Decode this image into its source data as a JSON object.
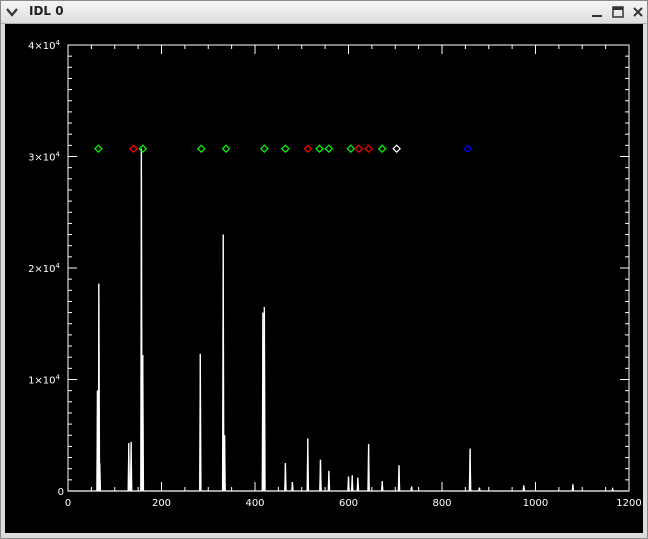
{
  "window": {
    "title": "IDL 0",
    "icons": {
      "menu": "chevron-down-icon",
      "minimize": "minimize-icon",
      "maximize": "maximize-icon",
      "close": "close-icon"
    }
  },
  "colors": {
    "plot_background": "#000000",
    "plot_line": "#ffffff",
    "marker_green": "#00ff00",
    "marker_red": "#ff0000",
    "marker_blue": "#0000ff",
    "marker_white": "#ffffff"
  },
  "chart_data": {
    "type": "line",
    "title": "",
    "xlabel": "",
    "ylabel": "",
    "xlim": [
      0,
      1200
    ],
    "ylim": [
      0,
      40000
    ],
    "xticks": [
      {
        "value": 0,
        "label": "0"
      },
      {
        "value": 200,
        "label": "200"
      },
      {
        "value": 400,
        "label": "400"
      },
      {
        "value": 600,
        "label": "600"
      },
      {
        "value": 800,
        "label": "800"
      },
      {
        "value": 1000,
        "label": "1000"
      },
      {
        "value": 1200,
        "label": "1200"
      }
    ],
    "yticks": [
      {
        "value": 0,
        "mantissa": "0",
        "exponent": ""
      },
      {
        "value": 10000,
        "mantissa": "1×10",
        "exponent": "4"
      },
      {
        "value": 20000,
        "mantissa": "2×10",
        "exponent": "4"
      },
      {
        "value": 30000,
        "mantissa": "3×10",
        "exponent": "4"
      },
      {
        "value": 40000,
        "mantissa": "4×10",
        "exponent": "4"
      }
    ],
    "peaks": [
      {
        "x": 63,
        "y": 9000
      },
      {
        "x": 66,
        "y": 18600
      },
      {
        "x": 68,
        "y": 2500
      },
      {
        "x": 130,
        "y": 4300
      },
      {
        "x": 135,
        "y": 4400
      },
      {
        "x": 157,
        "y": 30700
      },
      {
        "x": 160,
        "y": 12200
      },
      {
        "x": 283,
        "y": 12300
      },
      {
        "x": 332,
        "y": 23000
      },
      {
        "x": 335,
        "y": 5000
      },
      {
        "x": 417,
        "y": 16000
      },
      {
        "x": 420,
        "y": 16500
      },
      {
        "x": 465,
        "y": 2500
      },
      {
        "x": 480,
        "y": 800
      },
      {
        "x": 513,
        "y": 4700
      },
      {
        "x": 540,
        "y": 2800
      },
      {
        "x": 558,
        "y": 1800
      },
      {
        "x": 600,
        "y": 1300
      },
      {
        "x": 608,
        "y": 1400
      },
      {
        "x": 620,
        "y": 1200
      },
      {
        "x": 643,
        "y": 4200
      },
      {
        "x": 672,
        "y": 900
      },
      {
        "x": 708,
        "y": 2300
      },
      {
        "x": 735,
        "y": 400
      },
      {
        "x": 860,
        "y": 3800
      },
      {
        "x": 880,
        "y": 300
      },
      {
        "x": 975,
        "y": 500
      },
      {
        "x": 1080,
        "y": 600
      },
      {
        "x": 1165,
        "y": 200
      }
    ],
    "markers": [
      {
        "x": 65,
        "y": 30700,
        "color": "green"
      },
      {
        "x": 140,
        "y": 30700,
        "color": "red"
      },
      {
        "x": 160,
        "y": 30700,
        "color": "green"
      },
      {
        "x": 285,
        "y": 30700,
        "color": "green"
      },
      {
        "x": 338,
        "y": 30700,
        "color": "green"
      },
      {
        "x": 420,
        "y": 30700,
        "color": "green"
      },
      {
        "x": 465,
        "y": 30700,
        "color": "green"
      },
      {
        "x": 513,
        "y": 30700,
        "color": "red"
      },
      {
        "x": 538,
        "y": 30700,
        "color": "green"
      },
      {
        "x": 558,
        "y": 30700,
        "color": "green"
      },
      {
        "x": 605,
        "y": 30700,
        "color": "green"
      },
      {
        "x": 622,
        "y": 30700,
        "color": "red"
      },
      {
        "x": 643,
        "y": 30700,
        "color": "red"
      },
      {
        "x": 672,
        "y": 30700,
        "color": "green"
      },
      {
        "x": 703,
        "y": 30700,
        "color": "white"
      },
      {
        "x": 855,
        "y": 30700,
        "color": "blue"
      }
    ]
  }
}
